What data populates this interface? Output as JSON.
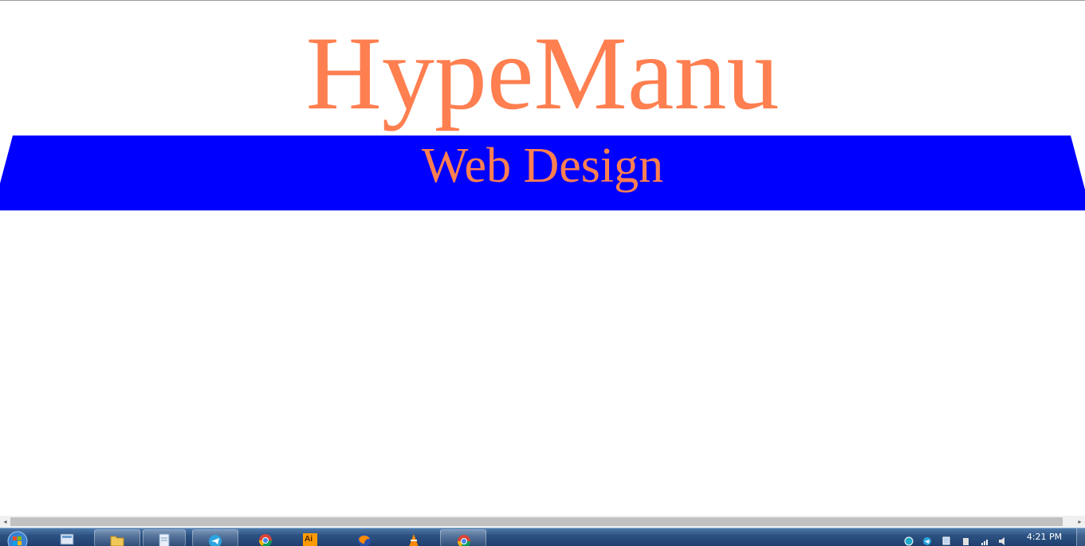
{
  "site": {
    "title": "HypeManu",
    "subtitle": "Web Design",
    "title_color": "#ff7f50",
    "banner_color": "#0000ff"
  },
  "scrollbar": {
    "left_arrow": "◂",
    "right_arrow": "▸"
  },
  "taskbar": {
    "clock": "4:21 PM",
    "items": [
      {
        "name": "start-button",
        "icon": "windows-orb-icon"
      },
      {
        "name": "taskbar-app-1",
        "icon": "control-panel-icon"
      },
      {
        "name": "taskbar-app-2",
        "icon": "folder-icon"
      },
      {
        "name": "taskbar-app-3",
        "icon": "notepad-icon"
      },
      {
        "name": "taskbar-app-4",
        "icon": "telegram-icon"
      },
      {
        "name": "taskbar-app-5",
        "icon": "chrome-icon"
      },
      {
        "name": "taskbar-app-6",
        "icon": "illustrator-icon"
      },
      {
        "name": "taskbar-app-7",
        "icon": "firefox-icon"
      },
      {
        "name": "taskbar-app-8",
        "icon": "vlc-icon"
      },
      {
        "name": "taskbar-app-9",
        "icon": "chrome-icon"
      }
    ],
    "illustrator_label": "Ai"
  }
}
